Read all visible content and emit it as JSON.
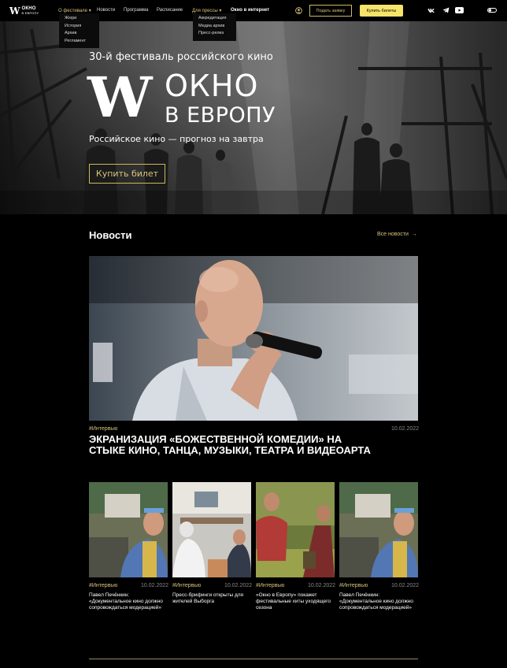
{
  "nav": {
    "logo_mark": "W",
    "logo_line1": "ОКНО",
    "logo_line2": "В ЕВРОПУ",
    "items": [
      "О фестивале",
      "Новости",
      "Программа",
      "Расписание",
      "Для прессы",
      "Окно в интернет"
    ],
    "about_dropdown": [
      "Жюри",
      "История",
      "Архив",
      "Регламент"
    ],
    "press_dropdown": [
      "Аккредитация",
      "Медиа архив",
      "Пресс-релиз"
    ],
    "apply_label": "Подать заявку",
    "tickets_label": "Купить билеты",
    "social_icons": [
      "vk-icon",
      "telegram-icon",
      "youtube-icon"
    ],
    "colors": {
      "accent": "#d8c47a",
      "button": "#f5e36a",
      "background": "#000000"
    }
  },
  "hero": {
    "subtitle": "30-й фестиваль российского кино",
    "title_line1": "ОКНО",
    "title_line2": "В ЕВРОПУ",
    "logo_mark": "W",
    "tagline": "Российское кино — прогноз на завтра",
    "cta_label": "Купить билет"
  },
  "news": {
    "section_title": "Новости",
    "all_label": "Все новости",
    "featured": {
      "tag": "#Интервью",
      "date": "10.02.2022",
      "title": "ЭКРАНИЗАЦИЯ «БОЖЕСТВЕННОЙ КОМЕДИИ» НА СТЫКЕ КИНО, ТАНЦА, МУЗЫКИ, ТЕАТРА И ВИДЕОАРТА"
    },
    "cards": [
      {
        "tag": "#Интервью",
        "date": "10.02.2022",
        "title": "Павел Печёнкин: «Документальное кино должно сопровождаться модерацией»"
      },
      {
        "tag": "#Интервью",
        "date": "10.02.2022",
        "title": "Пресс-брифинги открыты для жителей Выборга"
      },
      {
        "tag": "#Интервью",
        "date": "10.02.2022",
        "title": "«Окно в Европу» покажет фестивальные хиты уходящего сезона"
      },
      {
        "tag": "#Интервью",
        "date": "10.02.2022",
        "title": "Павел Печёнкин: «Документальное кино должно сопровождаться модерацией»"
      }
    ]
  }
}
